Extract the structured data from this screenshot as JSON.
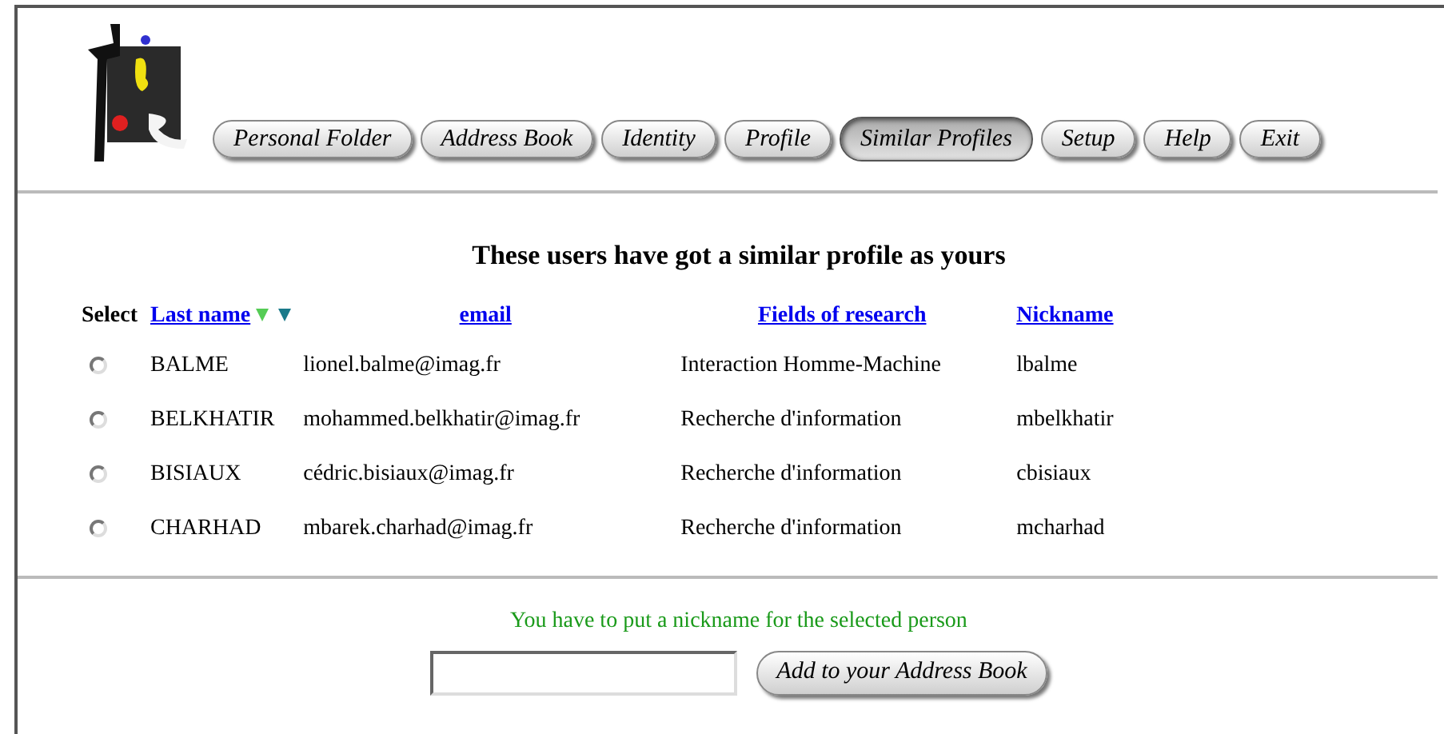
{
  "nav": [
    {
      "label": "Personal Folder",
      "selected": false
    },
    {
      "label": "Address Book",
      "selected": false
    },
    {
      "label": "Identity",
      "selected": false
    },
    {
      "label": "Profile",
      "selected": false
    },
    {
      "label": "Similar Profiles",
      "selected": true
    },
    {
      "label": "Setup",
      "selected": false
    },
    {
      "label": "Help",
      "selected": false
    },
    {
      "label": "Exit",
      "selected": false
    }
  ],
  "heading": "These users have got a similar profile as yours",
  "table": {
    "columns": [
      "Select",
      "Last name",
      "email",
      "Fields of research",
      "Nickname"
    ],
    "rows": [
      {
        "last_name": "BALME",
        "email": "lionel.balme@imag.fr",
        "field": "Interaction Homme-Machine",
        "nickname": "lbalme",
        "selected": false
      },
      {
        "last_name": "BELKHATIR",
        "email": "mohammed.belkhatir@imag.fr",
        "field": "Recherche d'information",
        "nickname": "mbelkhatir",
        "selected": false
      },
      {
        "last_name": "BISIAUX",
        "email": "cédric.bisiaux@imag.fr",
        "field": "Recherche d'information",
        "nickname": "cbisiaux",
        "selected": false
      },
      {
        "last_name": "CHARHAD",
        "email": "mbarek.charhad@imag.fr",
        "field": "Recherche d'information",
        "nickname": "mcharhad",
        "selected": false
      }
    ]
  },
  "message": "You have to put a nickname for the selected person",
  "add_button": "Add to your Address Book"
}
